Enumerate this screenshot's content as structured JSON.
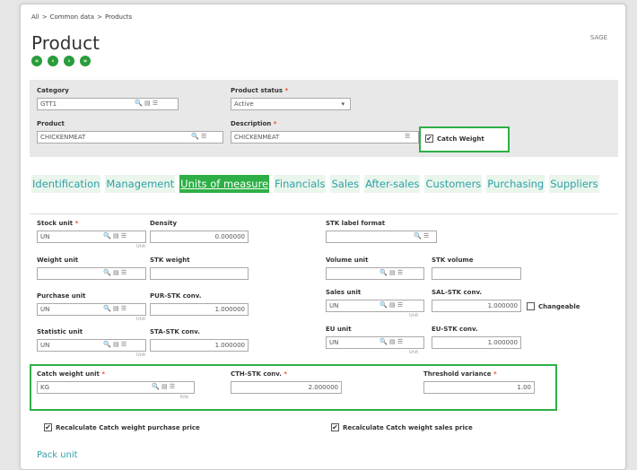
{
  "breadcrumb": {
    "all": "All",
    "sep1": ">",
    "common": "Common data",
    "sep2": ">",
    "products": "Products"
  },
  "page_title": "Product",
  "site": "SAGE",
  "nav_buttons": [
    "first",
    "previous",
    "next",
    "last"
  ],
  "header": {
    "category": {
      "label": "Category",
      "value": "GTT1"
    },
    "product_status": {
      "label": "Product status",
      "value": "Active"
    },
    "product": {
      "label": "Product",
      "value": "CHICKENMEAT"
    },
    "description": {
      "label": "Description",
      "value": "CHICKENMEAT"
    },
    "catch_weight": {
      "label": "Catch Weight",
      "checked": true
    }
  },
  "tabs": [
    "Identification",
    "Management",
    "Units of measure",
    "Financials",
    "Sales",
    "After-sales",
    "Customers",
    "Purchasing",
    "Suppliers"
  ],
  "active_tab": "Units of measure",
  "fields": {
    "stock_unit": {
      "label": "Stock unit",
      "value": "UN",
      "unit": "Unit"
    },
    "density": {
      "label": "Density",
      "value": "0.000000"
    },
    "stk_label_format": {
      "label": "STK label format",
      "value": ""
    },
    "weight_unit": {
      "label": "Weight unit",
      "value": ""
    },
    "stk_weight": {
      "label": "STK weight",
      "value": ""
    },
    "volume_unit": {
      "label": "Volume unit",
      "value": ""
    },
    "stk_volume": {
      "label": "STK volume",
      "value": ""
    },
    "purchase_unit": {
      "label": "Purchase unit",
      "value": "UN",
      "unit": "Unit"
    },
    "pur_stk_conv": {
      "label": "PUR-STK conv.",
      "value": "1.000000"
    },
    "sales_unit": {
      "label": "Sales unit",
      "value": "UN",
      "unit": "Unit"
    },
    "sal_stk_conv": {
      "label": "SAL-STK conv.",
      "value": "1.000000"
    },
    "changeable": {
      "label": "Changeable",
      "checked": false
    },
    "statistic_unit": {
      "label": "Statistic unit",
      "value": "UN",
      "unit": "Unit"
    },
    "sta_stk_conv": {
      "label": "STA-STK conv.",
      "value": "1.000000"
    },
    "eu_unit": {
      "label": "EU unit",
      "value": "UN",
      "unit": "Unit"
    },
    "eu_stk_conv": {
      "label": "EU-STK conv.",
      "value": "1.000000"
    },
    "catch_weight_unit": {
      "label": "Catch weight unit",
      "value": "KG",
      "unit": "Kilo"
    },
    "cth_stk_conv": {
      "label": "CTH-STK conv.",
      "value": "2.000000"
    },
    "threshold_variance": {
      "label": "Threshold variance",
      "value": "1.00"
    }
  },
  "recalc_purchase": {
    "label": "Recalculate Catch weight purchase price",
    "checked": true
  },
  "recalc_sales": {
    "label": "Recalculate Catch weight sales price",
    "checked": true
  },
  "pack_unit": "Pack unit",
  "icons": {
    "search": "🔍",
    "detail": "▤",
    "list": "☰",
    "check": "✔",
    "req": "*"
  },
  "colors": {
    "accent": "#2eaf45",
    "link": "#30a0a8",
    "required": "#e25822"
  }
}
